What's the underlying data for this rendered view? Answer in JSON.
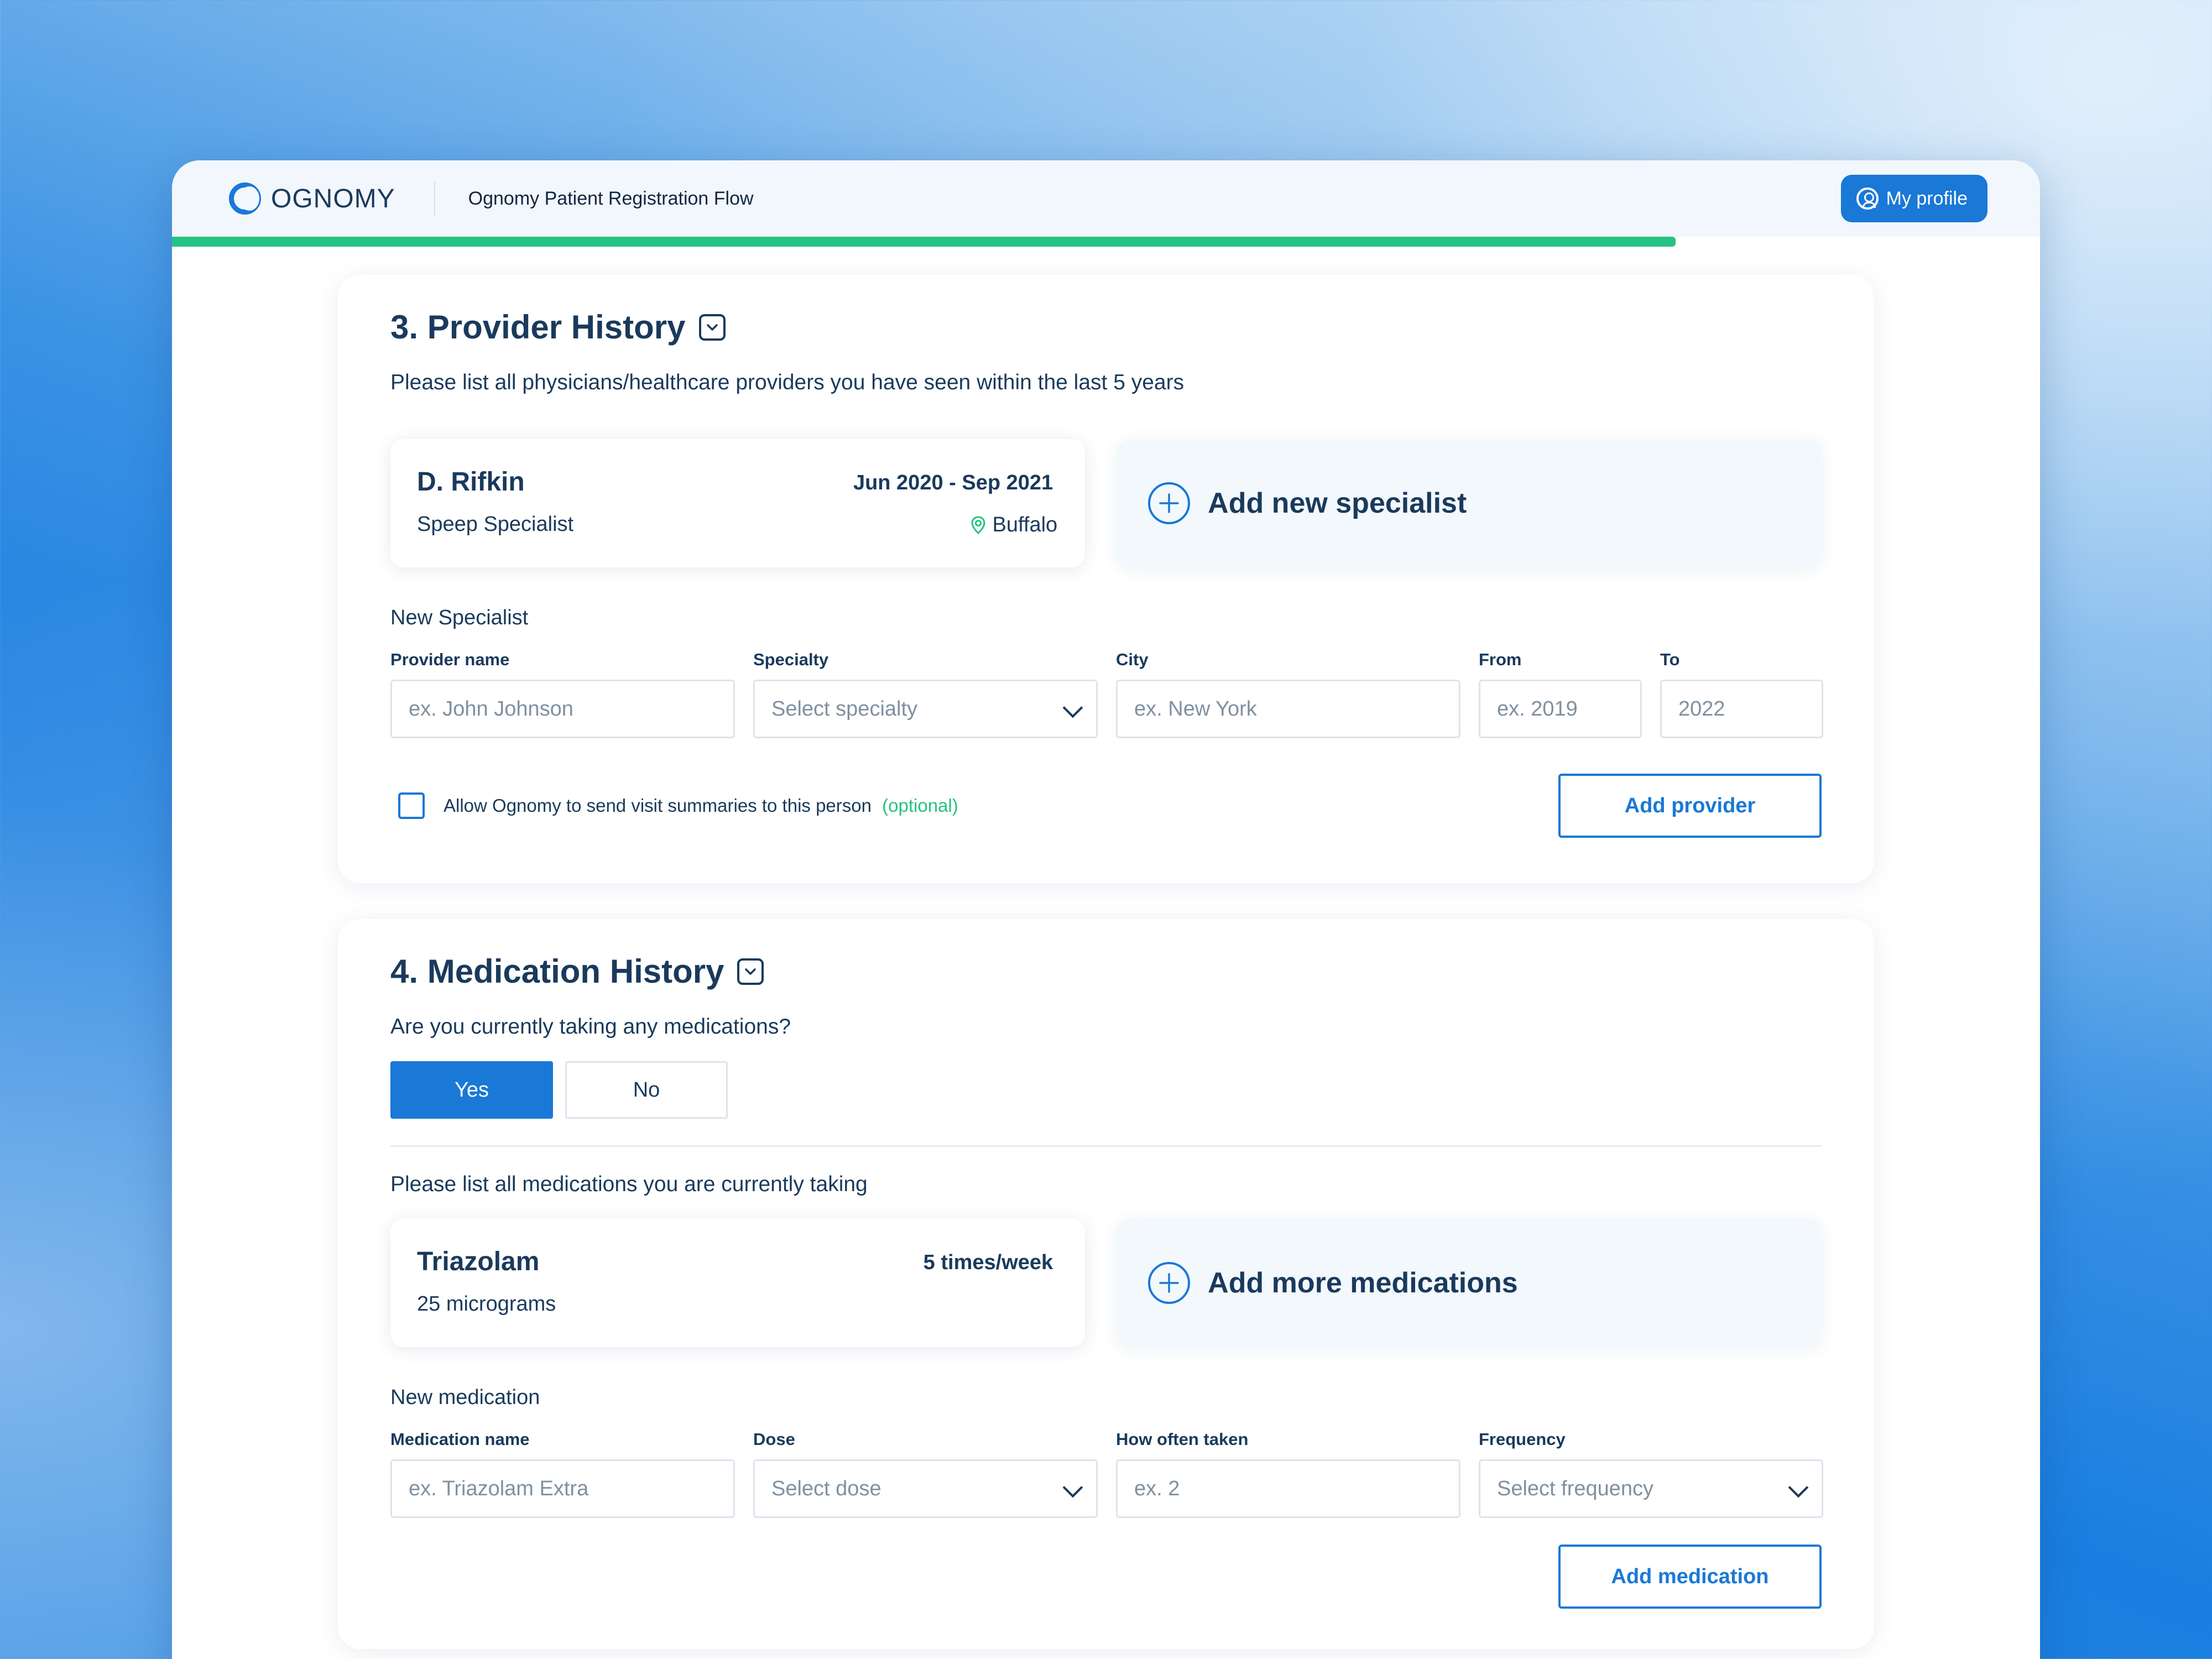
{
  "header": {
    "logo_text": "OGNOMY",
    "flow_title": "Ognomy Patient Registration Flow",
    "profile_label": "My profile",
    "progress_fraction": 0.805
  },
  "provider": {
    "title": "3. Provider History",
    "description": "Please list all physicians/healthcare providers you have seen within the last 5 years",
    "existing": {
      "name": "D. Rifkin",
      "specialty": "Speep Specialist",
      "dates": "Jun 2020 - Sep 2021",
      "city": "Buffalo"
    },
    "add_tile_label": "Add new specialist",
    "form_heading": "New Specialist",
    "fields": {
      "provider_name": {
        "label": "Provider name",
        "placeholder": "ex. John Johnson"
      },
      "specialty": {
        "label": "Specialty",
        "placeholder": "Select specialty"
      },
      "city": {
        "label": "City",
        "placeholder": "ex. New York"
      },
      "from": {
        "label": "From",
        "placeholder": "ex. 2019"
      },
      "to": {
        "label": "To",
        "placeholder": "2022"
      }
    },
    "consent_text": "Allow Ognomy to send visit summaries to this person",
    "consent_optional": "(optional)",
    "submit_label": "Add provider"
  },
  "medication": {
    "title": "4. Medication History",
    "question": "Are you currently taking any medications?",
    "yes_label": "Yes",
    "no_label": "No",
    "list_prompt": "Please list all medications you are currently taking",
    "existing": {
      "name": "Triazolam",
      "dose": "25 micrograms",
      "frequency": "5 times/week"
    },
    "add_tile_label": "Add more medications",
    "form_heading": "New medication",
    "fields": {
      "name": {
        "label": "Medication name",
        "placeholder": "ex. Triazolam Extra"
      },
      "dose": {
        "label": "Dose",
        "placeholder": "Select dose"
      },
      "how_often": {
        "label": "How often taken",
        "placeholder": "ex. 2"
      },
      "frequency": {
        "label": "Frequency",
        "placeholder": "Select frequency"
      }
    },
    "submit_label": "Add medication"
  },
  "colors": {
    "accent": "#1a78d6",
    "progress": "#26c281",
    "text": "#1a3a5c"
  }
}
